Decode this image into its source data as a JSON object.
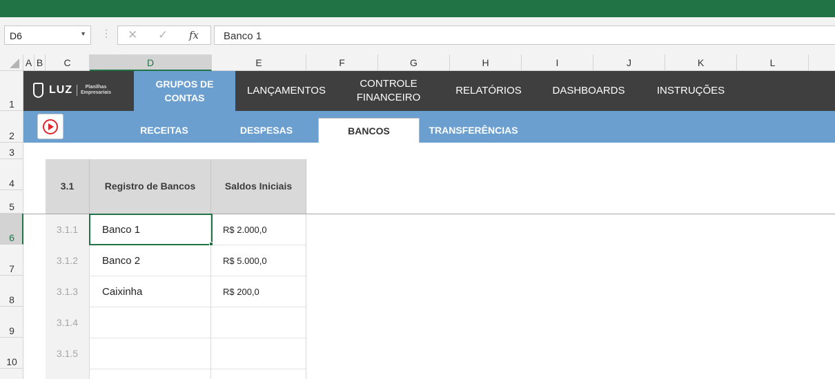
{
  "formula_bar": {
    "name_box": "D6",
    "formula": "Banco 1",
    "cancel_icon": "✕",
    "enter_icon": "✓",
    "fx_label": "fx"
  },
  "columns": [
    "A",
    "B",
    "C",
    "D",
    "E",
    "F",
    "G",
    "H",
    "I",
    "J",
    "K",
    "L"
  ],
  "rows": [
    "1",
    "2",
    "3",
    "4",
    "5",
    "6",
    "7",
    "8",
    "9",
    "10"
  ],
  "logo": {
    "word": "LUZ",
    "sub1": "Planilhas",
    "sub2": "Empresariais"
  },
  "nav": {
    "grupos": "GRUPOS DE CONTAS",
    "lancamentos": "LANÇAMENTOS",
    "controle": "CONTROLE FINANCEIRO",
    "relatorios": "RELATÓRIOS",
    "dashboards": "DASHBOARDS",
    "instrucoes": "INSTRUÇÕES"
  },
  "subnav": {
    "receitas": "RECEITAS",
    "despesas": "DESPESAS",
    "bancos": "BANCOS",
    "transferencias": "TRANSFERÊNCIAS"
  },
  "table": {
    "headers": [
      "3.1",
      "Registro de Bancos",
      "Saldos Iniciais"
    ],
    "rows": [
      {
        "num": "3.1.1",
        "name": "Banco 1",
        "value": "R$ 2.000,0"
      },
      {
        "num": "3.1.2",
        "name": "Banco 2",
        "value": "R$ 5.000,0"
      },
      {
        "num": "3.1.3",
        "name": "Caixinha",
        "value": "R$ 200,0"
      },
      {
        "num": "3.1.4",
        "name": "",
        "value": ""
      },
      {
        "num": "3.1.5",
        "name": "",
        "value": ""
      },
      {
        "num": "",
        "name": "",
        "value": ""
      }
    ]
  },
  "colors": {
    "excel_green": "#217346",
    "nav_dark": "#3f3f3f",
    "nav_blue": "#6a9fd0",
    "header_gray": "#d9d9d9",
    "play_red": "#e0242b"
  }
}
